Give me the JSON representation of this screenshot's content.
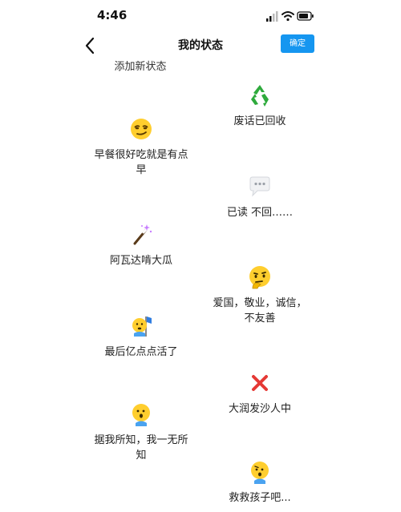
{
  "status_bar": {
    "time": "4:46"
  },
  "nav": {
    "title": "我的状态",
    "confirm_label": "确定"
  },
  "add_status_label": "添加新状态",
  "items": [
    {
      "label": "废话已回收",
      "icon": "recycle-icon"
    },
    {
      "label": "早餐很好吃就是有点早",
      "icon": "smug-face-icon"
    },
    {
      "label": "已读 不回……",
      "icon": "speech-bubble-icon"
    },
    {
      "label": "阿瓦达啃大瓜",
      "icon": "magic-wand-icon"
    },
    {
      "label": "爱国，敬业，诚信，不友善",
      "icon": "thinking-face-icon"
    },
    {
      "label": "最后亿点点活了",
      "icon": "waving-flag-face-icon"
    },
    {
      "label": "大润发沙人中",
      "icon": "cross-mark-icon"
    },
    {
      "label": "据我所知，我一无所知",
      "icon": "confused-face-icon"
    },
    {
      "label": "救救孩子吧...",
      "icon": "worried-face-icon"
    }
  ],
  "colors": {
    "accent": "#1596f0",
    "emoji_yellow": "#ffce2e",
    "cross_red": "#e53935",
    "recycle_green": "#2eaa3c"
  }
}
